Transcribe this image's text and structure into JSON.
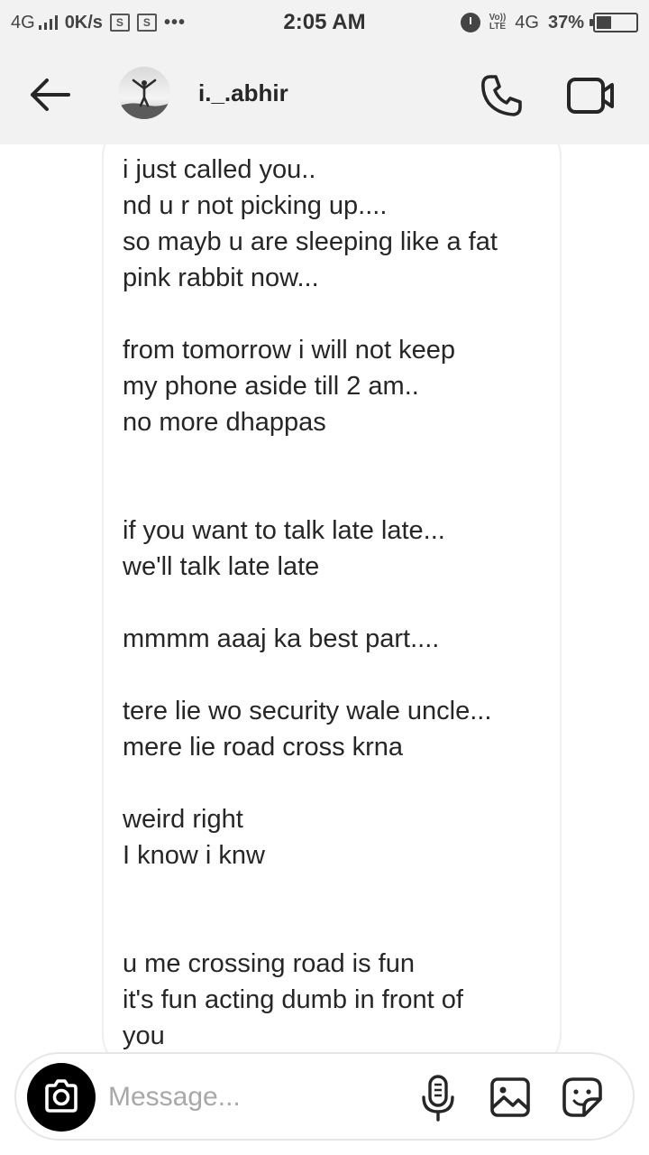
{
  "status_bar": {
    "network_left": "4G",
    "speed": "0K/s",
    "s_icon_letter": "S",
    "more_dots": "•••",
    "time": "2:05 AM",
    "volte_top": "Vo))",
    "volte_bottom": "LTE",
    "network_right": "4G",
    "battery_percent": "37%",
    "battery_level": 0.37
  },
  "header": {
    "username": "i._.abhir",
    "back_icon": "arrow-left-icon",
    "call_icon": "phone-icon",
    "video_icon": "video-camera-icon"
  },
  "thread": {
    "message_lines": [
      "i just called you..",
      "nd u r not picking up....",
      "so mayb u are sleeping like a fat",
      "pink rabbit now...",
      "",
      "from tomorrow i will not keep",
      "my phone aside till 2 am..",
      "no more dhappas",
      "",
      "",
      "if you want to talk late late...",
      "we'll talk late late",
      "",
      "mmmm aaaj ka best part....",
      "",
      "tere lie wo security wale uncle...",
      "mere lie road cross krna",
      "",
      "weird right",
      "I know i knw",
      "",
      "",
      "u me crossing road is fun",
      "it's fun acting dumb in front of",
      "you"
    ]
  },
  "composer": {
    "placeholder": "Message...",
    "camera_icon": "camera-icon",
    "mic_icon": "microphone-icon",
    "gallery_icon": "image-icon",
    "sticker_icon": "sticker-icon"
  },
  "colors": {
    "bar_background": "#f2f2f2",
    "text": "#262626",
    "placeholder": "#a8a8a8",
    "bubble_border": "#efefef"
  }
}
